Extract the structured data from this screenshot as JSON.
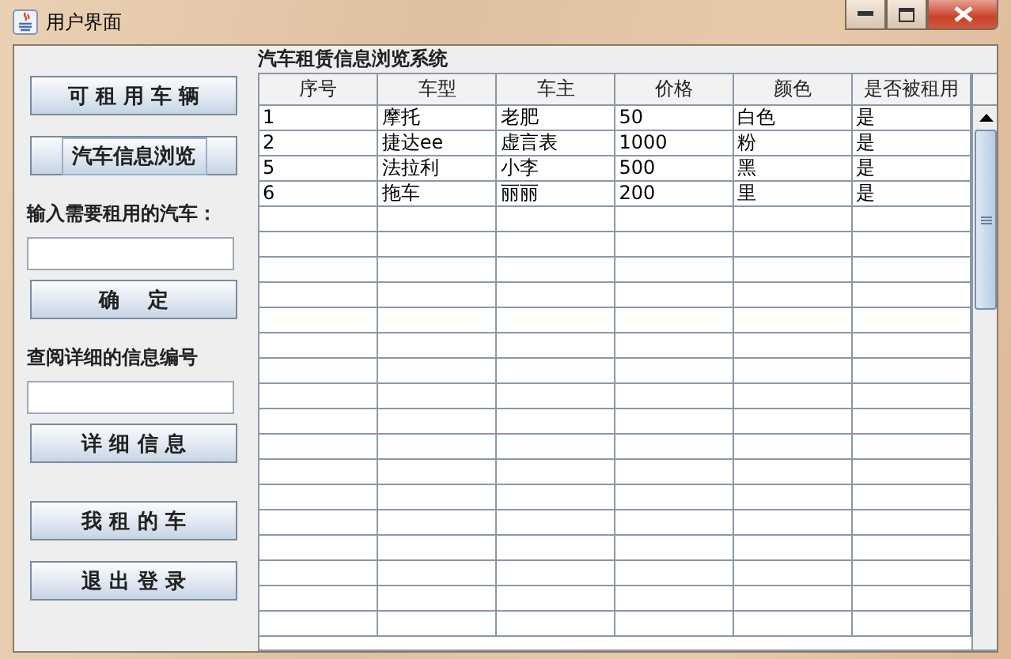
{
  "window": {
    "title": "用户界面"
  },
  "sidebar": {
    "buttons": [
      {
        "label": "可 租 用 车 辆",
        "focused": false
      },
      {
        "label": "汽车信息浏览",
        "focused": true
      }
    ],
    "rent_label": "输入需要租用的汽车：",
    "confirm_button": "确    定",
    "query_label": "查阅详细的信息编号",
    "bottom_buttons": [
      "详 细 信 息",
      "我 租 的 车",
      "退 出 登 录"
    ]
  },
  "table": {
    "title": "汽车租赁信息浏览系统",
    "columns": [
      "序号",
      "车型",
      "车主",
      "价格",
      "颜色",
      "是否被租用"
    ],
    "rows": [
      [
        "1",
        "摩托",
        "老肥",
        "50",
        "白色",
        "是"
      ],
      [
        "2",
        "捷达ee",
        "虚言表",
        "1000",
        "粉",
        "是"
      ],
      [
        "5",
        "法拉利",
        "小李",
        "500",
        "黑",
        "是"
      ],
      [
        "6",
        "拖车",
        "丽丽",
        "200",
        "里",
        "是"
      ]
    ]
  }
}
